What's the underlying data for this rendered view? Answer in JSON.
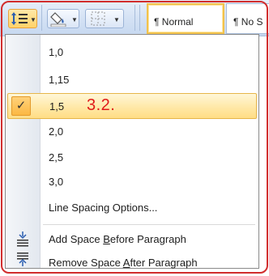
{
  "toolbar": {
    "line_spacing_icon": "line-spacing-icon",
    "shading_icon": "paint-bucket-icon",
    "borders_icon": "borders-icon"
  },
  "styles_gallery": {
    "normal": "¶ Normal",
    "no_spacing": "¶ No S"
  },
  "menu": {
    "spacing_options": [
      "1,0",
      "1,15",
      "1,5",
      "2,0",
      "2,5",
      "3,0"
    ],
    "selected_option": "1,5",
    "annotation": "3.2.",
    "line_spacing_options": "Line Spacing Options...",
    "add_space_before": {
      "pre": "Add Space ",
      "key": "B",
      "post": "efore Paragraph"
    },
    "remove_space_after": {
      "pre": "Remove Space ",
      "key": "A",
      "post": "fter Paragraph"
    }
  },
  "colors": {
    "highlight": "#ffe7a3",
    "annotation": "#e01a1a",
    "frame": "#d12d2d"
  }
}
